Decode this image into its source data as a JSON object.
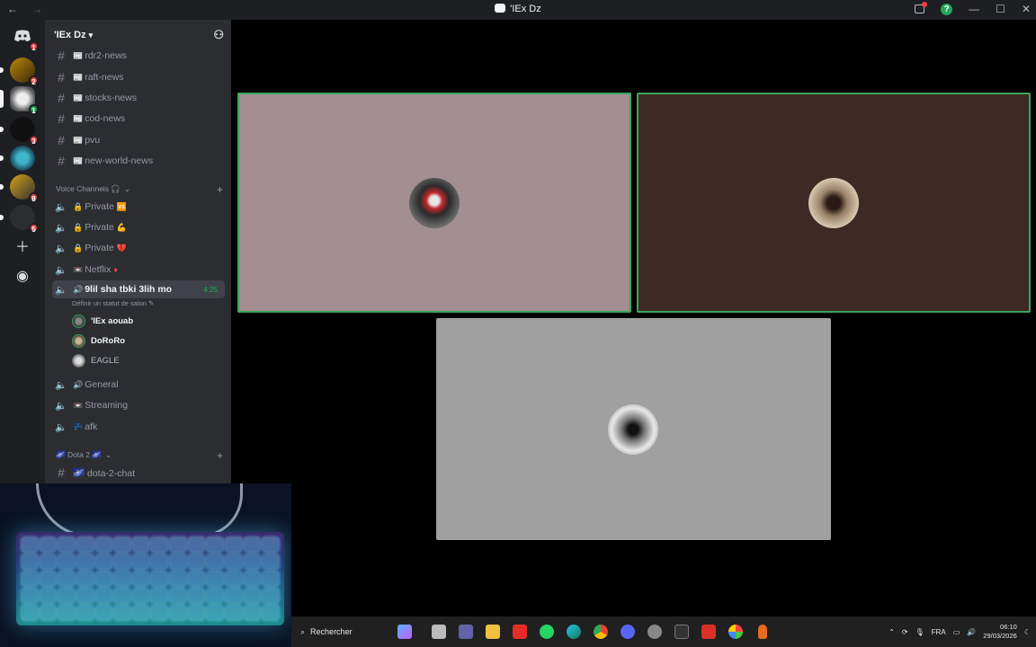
{
  "window": {
    "title": "'IEx Dz",
    "nav_back": "←",
    "nav_fwd": "→",
    "controls": {
      "minimize": "—",
      "maximize": "☐",
      "close": "✕"
    },
    "help": "?"
  },
  "servers": {
    "badges": [
      "1",
      "2",
      "1",
      "3",
      "8",
      "5"
    ]
  },
  "guild": {
    "name": "'IEx Dz",
    "channels": [
      {
        "label": "rdr2-news",
        "icon": "text"
      },
      {
        "label": "raft-news",
        "icon": "text"
      },
      {
        "label": "stocks-news",
        "icon": "text"
      },
      {
        "label": "cod-news",
        "icon": "text"
      },
      {
        "label": "pvu",
        "icon": "text"
      },
      {
        "label": "new-world-news",
        "icon": "text"
      }
    ],
    "voice_category": "Voice Channels 🎧",
    "voice_channels": [
      {
        "prefix": "🔒",
        "label": "Private",
        "suffix": "🆚"
      },
      {
        "prefix": "🔒",
        "label": "Private",
        "suffix": "💪"
      },
      {
        "prefix": "🔒",
        "label": "Private",
        "suffix": "💔"
      },
      {
        "prefix": "📼",
        "label": "Netflix",
        "suffix": "♦"
      }
    ],
    "active_channel": {
      "prefix": "🔊",
      "label": "9lil sha tbki 3lih mo",
      "timer": "4:25",
      "status": "Définir un statut de salon ✎"
    },
    "voice_users": [
      "'IEx aouab",
      "DoRoRo",
      "EAGLE"
    ],
    "more_voice": [
      {
        "prefix": "🔊",
        "label": "General"
      },
      {
        "prefix": "📼",
        "label": "Streaming"
      },
      {
        "prefix": "💤",
        "label": "afk"
      }
    ],
    "dota_category": "🌌 Dota 2 🌌",
    "dota_channel": "🌌 dota-2-chat"
  },
  "taskbar": {
    "search_label": "Rechercher",
    "lang": "FRA",
    "time": "06:10",
    "date": "29/03/2026"
  },
  "colors": {
    "speaking": "#3ba55c",
    "tile1": "#a38e92",
    "tile2": "#3d2a24",
    "tile3": "#a0a0a0"
  }
}
